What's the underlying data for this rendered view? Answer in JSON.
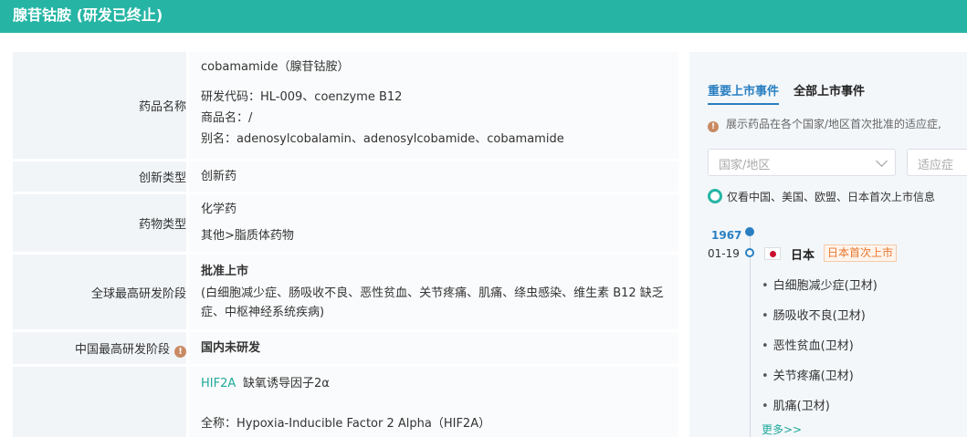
{
  "header": {
    "title": "腺苷钴胺 (研发已终止)"
  },
  "table": {
    "drug_name": {
      "label": "药品名称",
      "main_name": "cobamamide（腺苷钴胺）",
      "code": "研发代码：HL-009、coenzyme B12",
      "trade_name": "商品名：/",
      "alias": "别名：adenosylcobalamin、adenosylcobamide、cobamamide"
    },
    "innovation_type": {
      "label": "创新类型",
      "value": "创新药"
    },
    "drug_type": {
      "label": "药物类型",
      "value1": "化学药",
      "value2": "其他>脂质体药物"
    },
    "global_stage": {
      "label": "全球最高研发阶段",
      "stage": "批准上市",
      "indications_line1": "(白细胞减少症、肠吸收不良、恶性贫血、关节疼痛、肌痛、绦虫感染、维生素 B12 缺乏",
      "indications_line2": "症、中枢神经系统疾病)"
    },
    "china_stage": {
      "label": "中国最高研发阶段",
      "info_icon": "info-icon",
      "value": "国内未研发"
    },
    "target": {
      "code": "HIF2A",
      "name": "缺氧诱导因子2α",
      "fullname": "全称：Hypoxia-Inducible Factor 2 Alpha（HIF2A）"
    }
  },
  "panel": {
    "tabs": [
      {
        "label": "重要上市事件",
        "active": true
      },
      {
        "label": "全部上市事件",
        "active": false
      }
    ],
    "tip": "展示药品在各个国家/地区首次批准的适应症,",
    "country_select_placeholder": "国家/地区",
    "indication_select_placeholder": "适应症",
    "radio_label": "仅看中国、美国、欧盟、日本首次上市信息",
    "timeline": {
      "year": "1967",
      "date": "01-19",
      "country": "日本",
      "badge": "日本首次上市",
      "indications": [
        "白细胞减少症(卫材)",
        "肠吸收不良(卫材)",
        "恶性贫血(卫材)",
        "关节疼痛(卫材)",
        "肌痛(卫材)"
      ],
      "more": "更多>>"
    }
  },
  "colors": {
    "header_bg": "#26b5a5",
    "accent_blue": "#2a7fc1",
    "teal": "#1fa99a",
    "badge_orange": "#e8762f"
  }
}
